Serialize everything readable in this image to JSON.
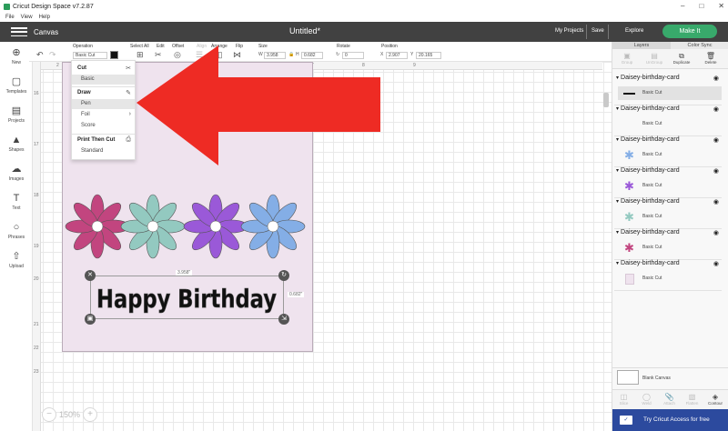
{
  "window": {
    "title": "Cricut Design Space  v7.2.87",
    "controls": [
      "–",
      "□",
      "✕"
    ]
  },
  "menu": {
    "items": [
      "File",
      "View",
      "Help"
    ]
  },
  "header": {
    "section": "Canvas",
    "document_title": "Untitled*",
    "my_projects": "My Projects",
    "save": "Save",
    "explore": "Explore",
    "make_it": "Make It",
    "make_it_color": "#38a96b"
  },
  "toolbar": {
    "operation_label": "Operation",
    "operation_value": "Basic Cut",
    "operation_color": "#000000",
    "select_all": "Select All",
    "edit": "Edit",
    "offset": "Offset",
    "align": "Align",
    "arrange": "Arrange",
    "flip": "Flip",
    "size_label": "Size",
    "size_w_prefix": "W",
    "size_w": "3.958",
    "size_h_prefix": "H",
    "size_h": "0.682",
    "rotate_label": "Rotate",
    "rotate_value": "0",
    "position_label": "Position",
    "pos_x_prefix": "X",
    "pos_x": "2.907",
    "pos_y_prefix": "Y",
    "pos_y": "20.165"
  },
  "left_sidebar": {
    "items": [
      {
        "label": "New",
        "icon": "plus-circle-icon"
      },
      {
        "label": "Templates",
        "icon": "shirt-icon"
      },
      {
        "label": "Projects",
        "icon": "projects-icon"
      },
      {
        "label": "Shapes",
        "icon": "shapes-icon"
      },
      {
        "label": "Images",
        "icon": "images-icon"
      },
      {
        "label": "Text",
        "icon": "text-icon"
      },
      {
        "label": "Phrases",
        "icon": "phrases-icon"
      },
      {
        "label": "Upload",
        "icon": "upload-icon"
      }
    ]
  },
  "rulers": {
    "top": [
      "2",
      "3",
      "4",
      "5",
      "6",
      "7",
      "8",
      "9"
    ],
    "left": [
      "16",
      "17",
      "18",
      "19",
      "20",
      "21",
      "22",
      "23"
    ]
  },
  "operation_dropdown": {
    "cut_heading": "Cut",
    "basic": "Basic",
    "draw_heading": "Draw",
    "pen": "Pen",
    "foil": "Foil",
    "score": "Score",
    "print_heading": "Print Then Cut",
    "standard": "Standard"
  },
  "canvas": {
    "card_color": "#efe3ee",
    "flower_colors": [
      "#c2457f",
      "#93c9c0",
      "#9a59d8",
      "#84aee6"
    ],
    "text": "Happy Birthday",
    "width_label": "3.958\"",
    "height_label": "0.682\"",
    "zoom": "150%",
    "arrow_color": "#ee2b24"
  },
  "right_panel": {
    "tabs": [
      "Layers",
      "Color Sync"
    ],
    "tools": [
      "Group",
      "UnGroup",
      "Duplicate",
      "Delete"
    ],
    "layers": [
      {
        "name": "Daisey-birthday-card",
        "sub": "Basic Cut",
        "thumb": "text",
        "color": "#111111"
      },
      {
        "name": "Daisey-birthday-card",
        "sub": "Basic Cut",
        "thumb": "none",
        "color": "#ffffff"
      },
      {
        "name": "Daisey-birthday-card",
        "sub": "Basic Cut",
        "thumb": "flower",
        "color": "#84aee6"
      },
      {
        "name": "Daisey-birthday-card",
        "sub": "Basic Cut",
        "thumb": "flower",
        "color": "#9a59d8"
      },
      {
        "name": "Daisey-birthday-card",
        "sub": "Basic Cut",
        "thumb": "flower",
        "color": "#93c9c0"
      },
      {
        "name": "Daisey-birthday-card",
        "sub": "Basic Cut",
        "thumb": "flower",
        "color": "#c2457f"
      },
      {
        "name": "Daisey-birthday-card",
        "sub": "Basic Cut",
        "thumb": "square",
        "color": "#efe3ee"
      }
    ],
    "blank_canvas": "Blank Canvas",
    "bottom_tools": [
      "Slice",
      "Weld",
      "Attach",
      "Flatten",
      "Contour"
    ],
    "access": "Try Cricut Access for free"
  }
}
